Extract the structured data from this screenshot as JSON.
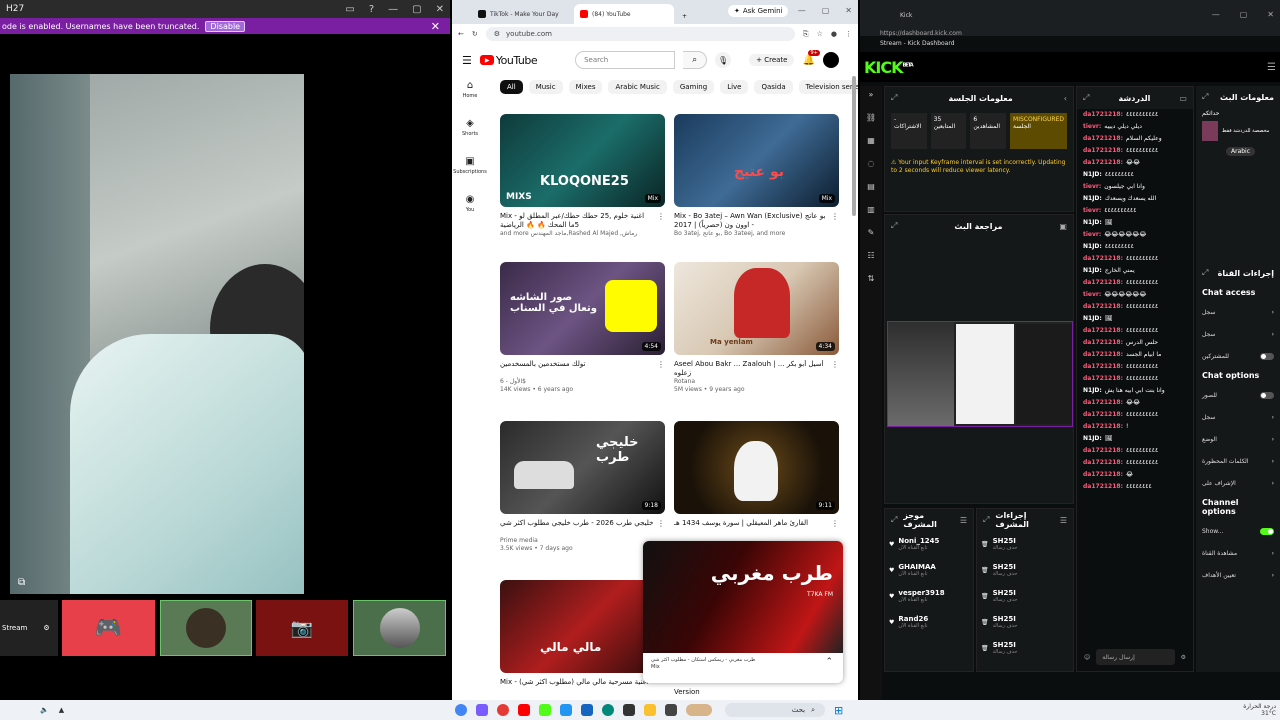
{
  "left_window": {
    "title": "H27",
    "banner": {
      "text": "ode is enabled. Usernames have been truncated.",
      "button": "Disable"
    },
    "stream_tile_label": "Stream"
  },
  "browser": {
    "tabs": [
      "TikTok - Make Your Day",
      "(84) YouTube"
    ],
    "new_tab": "+",
    "gemini": "Ask Gemini",
    "url": "youtube.com",
    "logo": "YouTube",
    "search_placeholder": "Search",
    "create_label": "Create",
    "notif_count": "9+",
    "chips": [
      "All",
      "Music",
      "Mixes",
      "Arabic Music",
      "Gaming",
      "Live",
      "Qasida",
      "Television series"
    ],
    "sidebar": [
      "Home",
      "Shorts",
      "Subscriptions",
      "You"
    ],
    "videos": [
      {
        "title": "Mix - اغنية خلوم ,25 حطك حطك/عبر المطلق لو 5ما المحك 🔥 🔥 الرياضية",
        "meta1": "and more ماجد المهندس,Rashed Al Majed ,رماش",
        "meta2": "",
        "duration": "Mix",
        "thumb_text": "KLOQONE25",
        "badge": "MIXS"
      },
      {
        "title": "Mix - Bo 3atej – Awn Wan (Exclusive) بو عاتج - اوون ون (حصرياً) | 2017",
        "meta1": "Bo 3atej, بو عاتج, Bo 3ateej, and more",
        "meta2": "",
        "duration": "Mix",
        "thumb_text": "بو عتيج",
        "badge": ""
      },
      {
        "title": "تولك مستخدمين بالمسخدمين",
        "meta1": "الأول - 6$",
        "meta2": "14K views • 6 years ago",
        "duration": "4:54",
        "thumb_text": "صور الشاشه وتعال في السناب",
        "badge": ""
      },
      {
        "title": "Aseel Abou Bakr ... Zaalouh | أسيل أبو بكر ... زعلوه",
        "meta1": "Rotana",
        "meta2": "5M views • 9 years ago",
        "duration": "4:34",
        "thumb_text": "Ma yenlam",
        "badge": ""
      },
      {
        "title": "خليجي طرب 2026 - طرب خليجي مطلوب اكثر شي",
        "meta1": "Prime media",
        "meta2": "3.5K views • 7 days ago",
        "duration": "9:18",
        "thumb_text": "خليجي طرب",
        "badge": ""
      },
      {
        "title": "القارئ ماهر المعيقلي | سورة يوسف 1434 هـ",
        "meta1": "",
        "meta2": "",
        "duration": "9:11",
        "thumb_text": "",
        "badge": ""
      },
      {
        "title": "Mix - اغنية مسرحية مالي مالي (مطلوب اكثر شي)",
        "meta1": "",
        "meta2": "",
        "duration": "",
        "thumb_text": "مالي مالي",
        "badge": ""
      }
    ],
    "miniplayer": {
      "title": "طرب مغربي",
      "sub": "T7KA FM",
      "line1": "طرب مغربي - ريمكس استكان - مطلوب اكثر شي",
      "line2": "Mix",
      "extra": "Version"
    }
  },
  "kick": {
    "tab_title": "Kick",
    "url": "https://dashboard.kick.com",
    "tab2": "Stream - Kick Dashboard",
    "logo": "KICK",
    "logo_sup": "BETA",
    "session_info": {
      "title": "معلومات الجلسة",
      "status": "MISCONFIGURED",
      "viewers_value": "6",
      "viewers_label": "المشاهدين",
      "followers_value": "35",
      "followers_label": "المتابعين",
      "subs_value": "-",
      "subs_label": "الاشتراكات",
      "session_label": "الجلسة",
      "warning": "Your input Keyframe interval is set incorrectly. Updating to 2 seconds will reduce viewer latency."
    },
    "preview_title": "مراجعة البث",
    "mods_title": "موجز المشرف",
    "actions_title": "إجراءات المشرف",
    "mod_rows": [
      {
        "name": "Noni_1245",
        "sub": "تابع القناة الآن"
      },
      {
        "name": "GHAIMAA",
        "sub": "تابع القناة الآن"
      },
      {
        "name": "vesper3918",
        "sub": "تابع القناة الآن"
      },
      {
        "name": "Rand26",
        "sub": "تابع القناة الآن"
      }
    ],
    "action_rows": [
      {
        "name": "SH25I",
        "sub": "حذف رسالة"
      },
      {
        "name": "SH25I",
        "sub": "حذف رسالة"
      },
      {
        "name": "SH25I",
        "sub": "حذف رسالة"
      },
      {
        "name": "SH25I",
        "sub": "حذف رسالة"
      },
      {
        "name": "SH25I",
        "sub": "حذف رسالة"
      },
      {
        "name": "SH25I",
        "sub": "حذف رسالة"
      }
    ],
    "chat_title": "الدردشة",
    "chat": [
      {
        "user": "da1721218:",
        "msg": "٤٤٤٤٤٤٤٤٤٤",
        "c": "u"
      },
      {
        "user": "tievr:",
        "msg": "ديلي ديلي ديييه",
        "c": "u"
      },
      {
        "user": "da1721218:",
        "msg": "وعليكم السلام",
        "c": "u"
      },
      {
        "user": "da1721218:",
        "msg": "٤٤٤٤٤٤٤٤٤٤",
        "c": "u"
      },
      {
        "user": "da1721218:",
        "msg": "😂😂",
        "c": "u"
      },
      {
        "user": "N1JD:",
        "msg": "٤٤٤٤٤٤٤٤٤",
        "c": "u3"
      },
      {
        "user": "tievr:",
        "msg": "وانا ابي جيلسون",
        "c": "u"
      },
      {
        "user": "N1JD:",
        "msg": "الله يسعدك ويسعدك",
        "c": "u3"
      },
      {
        "user": "tievr:",
        "msg": "٤٤٤٤٤٤٤٤٤٤",
        "c": "u"
      },
      {
        "user": "N1JD:",
        "msg": "🖼",
        "c": "u3"
      },
      {
        "user": "tievr:",
        "msg": "😂😂😂😂😂😂",
        "c": "u"
      },
      {
        "user": "N1JD:",
        "msg": "٤٤٤٤٤٤٤٤٤",
        "c": "u3"
      },
      {
        "user": "da1721218:",
        "msg": "٤٤٤٤٤٤٤٤٤٤",
        "c": "u"
      },
      {
        "user": "N1JD:",
        "msg": "يمني الخارج",
        "c": "u3"
      },
      {
        "user": "da1721218:",
        "msg": "٤٤٤٤٤٤٤٤٤٤",
        "c": "u"
      },
      {
        "user": "tievr:",
        "msg": "😂😂😂😂😂😂",
        "c": "u"
      },
      {
        "user": "da1721218:",
        "msg": "٤٤٤٤٤٤٤٤٤٤",
        "c": "u"
      },
      {
        "user": "N1JD:",
        "msg": "🖼",
        "c": "u3"
      },
      {
        "user": "da1721218:",
        "msg": "٤٤٤٤٤٤٤٤٤٤",
        "c": "u"
      },
      {
        "user": "da1721218:",
        "msg": "حلس الدرس",
        "c": "u"
      },
      {
        "user": "da1721218:",
        "msg": "ما ابيام الجسد",
        "c": "u"
      },
      {
        "user": "da1721218:",
        "msg": "٤٤٤٤٤٤٤٤٤٤",
        "c": "u"
      },
      {
        "user": "da1721218:",
        "msg": "٤٤٤٤٤٤٤٤٤٤",
        "c": "u"
      },
      {
        "user": "N1JD:",
        "msg": "وانا بنت ابي ابيه هنا يش",
        "c": "u3"
      },
      {
        "user": "da1721218:",
        "msg": "😂😂",
        "c": "u"
      },
      {
        "user": "da1721218:",
        "msg": "٤٤٤٤٤٤٤٤٤٤",
        "c": "u"
      },
      {
        "user": "da1721218:",
        "msg": "!",
        "c": "u"
      },
      {
        "user": "N1JD:",
        "msg": "🖼",
        "c": "u3"
      },
      {
        "user": "da1721218:",
        "msg": "٤٤٤٤٤٤٤٤٤٤",
        "c": "u"
      },
      {
        "user": "da1721218:",
        "msg": "٤٤٤٤٤٤٤٤٤٤",
        "c": "u"
      },
      {
        "user": "da1721218:",
        "msg": "😂",
        "c": "u"
      },
      {
        "user": "da1721218:",
        "msg": "٤٤٤٤٤٤٤٤",
        "c": "u"
      }
    ],
    "chat_input": "إرسال رسالة",
    "stream_info_title": "معلومات البث",
    "stream_info_line": "حداثكم",
    "stream_info_cat": "مخصصة للدردشة فقط",
    "stream_info_lang": "Arabic",
    "channel_actions_title": "إجراءات القناة",
    "chat_access": "Chat access",
    "access_opts": [
      "سجل",
      "سجل",
      "للمشتركين"
    ],
    "chat_options": "Chat options",
    "chat_opts": [
      "للصور",
      "سجل",
      "الوضع",
      "الكلمات المحظورة",
      "الإشراف على"
    ],
    "channel_options": "Channel options",
    "channel_opts": [
      "Show...",
      "مشاهدة القناة",
      "تعيين الأهداف"
    ]
  },
  "taskbar": {
    "search": "بحث",
    "clock_line1": "درجة الحرارة",
    "clock_line2": "31°C"
  }
}
